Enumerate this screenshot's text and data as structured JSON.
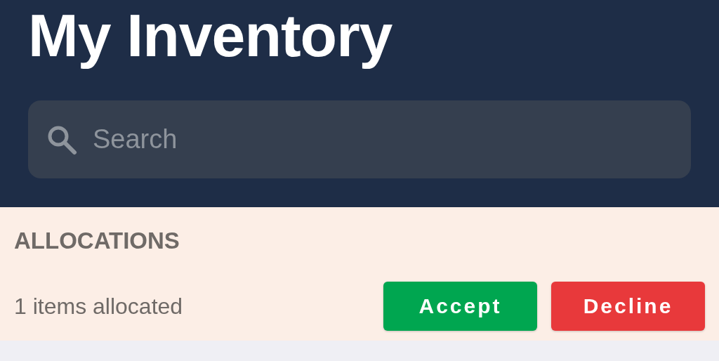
{
  "header": {
    "title": "My Inventory"
  },
  "search": {
    "placeholder": "Search"
  },
  "allocations": {
    "heading": "ALLOCATIONS",
    "summary": "1 items allocated",
    "buttons": [
      {
        "label": "Accept",
        "kind": "accept"
      },
      {
        "label": "Decline",
        "kind": "decline"
      }
    ]
  }
}
